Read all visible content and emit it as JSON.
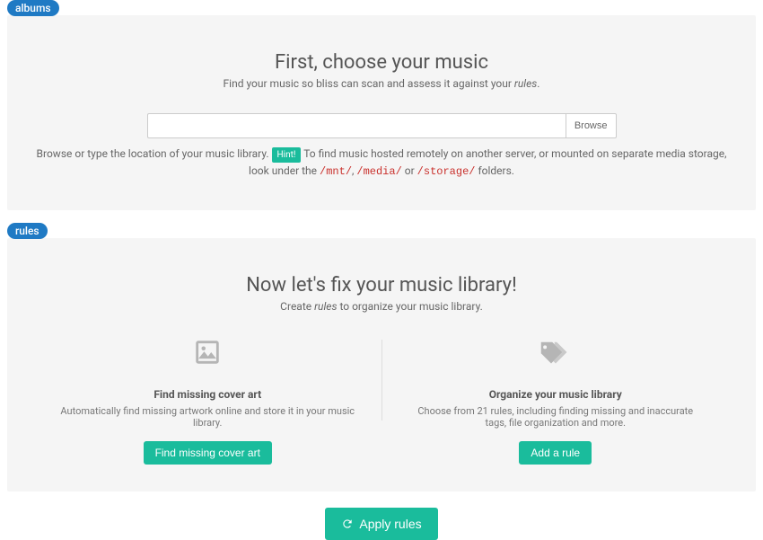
{
  "sections": {
    "albums": {
      "tag": "albums",
      "title": "First, choose your music",
      "subtitle_left": "Find your music so bliss can scan and assess it against your ",
      "subtitle_em": "rules",
      "subtitle_right": ".",
      "input_value": "",
      "browse_label": "Browse",
      "hint_before": "Browse or type the location of your music library. ",
      "hint_badge": "Hint!",
      "hint_after": " To find music hosted remotely on another server, or mounted on separate media storage, look under the ",
      "hint_p1": "/mnt/",
      "hint_sep1": ", ",
      "hint_p2": "/media/",
      "hint_or": " or ",
      "hint_p3": "/storage/",
      "hint_end": " folders."
    },
    "rules": {
      "tag": "rules",
      "title": "Now let's fix your music library!",
      "subtitle_left": "Create ",
      "subtitle_em": "rules",
      "subtitle_right": " to organize your music library.",
      "cards": {
        "coverart": {
          "title": "Find missing cover art",
          "desc": "Automatically find missing artwork online and store it in your music library.",
          "button": "Find missing cover art"
        },
        "organize": {
          "title": "Organize your music library",
          "desc": "Choose from 21 rules, including finding missing and inaccurate tags, file organization and more.",
          "button": "Add a rule"
        }
      }
    }
  },
  "apply": "Apply rules"
}
